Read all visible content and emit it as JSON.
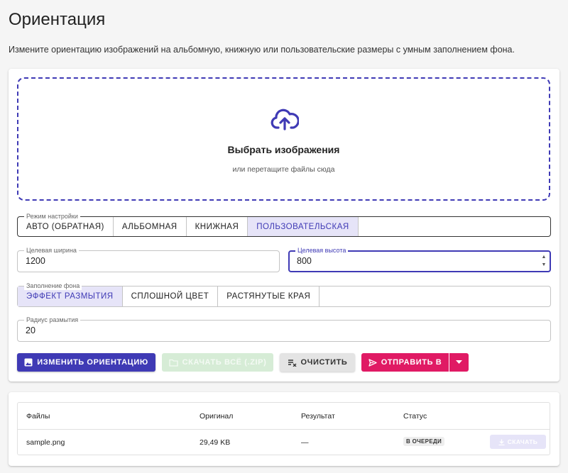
{
  "page": {
    "title": "Ориентация",
    "description": "Измените ориентацию изображений на альбомную, книжную или пользовательские размеры с умным заполнением фона."
  },
  "dropzone": {
    "icon": "cloud-upload-icon",
    "title": "Выбрать изображения",
    "subtitle": "или перетащите файлы сюда"
  },
  "mode": {
    "legend": "Режим настройки",
    "options": [
      "АВТО (ОБРАТНАЯ)",
      "АЛЬБОМНАЯ",
      "КНИЖНАЯ",
      "ПОЛЬЗОВАТЕЛЬСКАЯ"
    ],
    "selected": "ПОЛЬЗОВАТЕЛЬСКАЯ"
  },
  "target_width": {
    "legend": "Целевая ширина",
    "value": "1200"
  },
  "target_height": {
    "legend": "Целевая высота",
    "value": "800"
  },
  "fill": {
    "legend": "Заполнение фона",
    "options": [
      "ЭФФЕКТ РАЗМЫТИЯ",
      "СПЛОШНОЙ ЦВЕТ",
      "РАСТЯНУТЫЕ КРАЯ"
    ],
    "selected": "ЭФФЕКТ РАЗМЫТИЯ"
  },
  "blur_radius": {
    "legend": "Радиус размытия",
    "value": "20"
  },
  "actions": {
    "rotate": "ИЗМЕНИТЬ ОРИЕНТАЦИЮ",
    "download_all": "СКАЧАТЬ ВСЁ (.ZIP)",
    "clear": "ОЧИСТИТЬ",
    "send": "ОТПРАВИТЬ В"
  },
  "table": {
    "headers": [
      "Файлы",
      "Оригинал",
      "Результат",
      "Статус"
    ],
    "rows": [
      {
        "file": "sample.png",
        "original": "29,49 KB",
        "result": "—",
        "status": "В ОЧЕРЕДИ",
        "action": "СКАЧАТЬ"
      }
    ]
  },
  "colors": {
    "primary": "#3f3ab5",
    "accent": "#e01a64",
    "selected_bg": "#e6e4f8",
    "disabled_success": "#d6ecd6"
  }
}
